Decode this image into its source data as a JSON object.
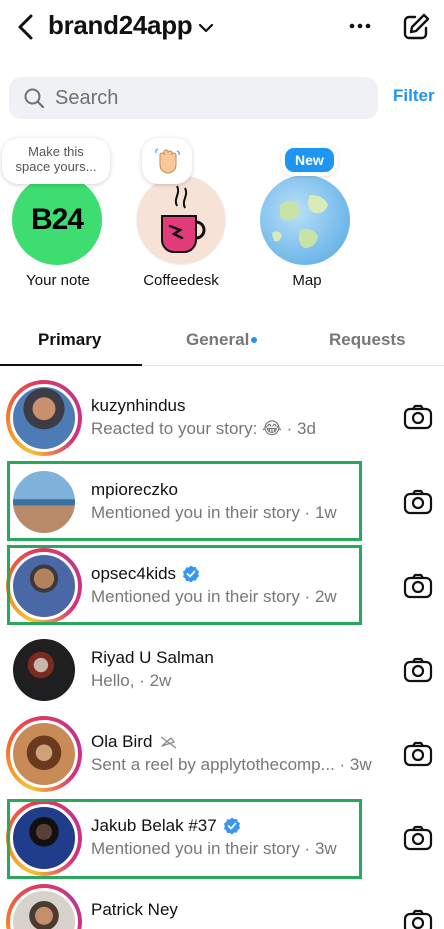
{
  "header": {
    "title": "brand24app",
    "icons": [
      "back-icon",
      "chevron-down-icon",
      "more-icon",
      "compose-icon"
    ]
  },
  "search": {
    "placeholder": "Search",
    "filter_label": "Filter"
  },
  "notes": [
    {
      "label": "Your note",
      "bubble": "Make this space yours...",
      "avatar_text": "B24",
      "avatar_color": "#3ddd72"
    },
    {
      "label": "Coffeedesk",
      "bubble_icon": "waving-hand-icon"
    },
    {
      "label": "Map",
      "badge": "New"
    }
  ],
  "tabs": [
    {
      "label": "Primary",
      "active": true
    },
    {
      "label": "General",
      "unread_dot": true
    },
    {
      "label": "Requests"
    }
  ],
  "threads": [
    {
      "name": "kuzynhindus",
      "message": "Reacted to your story: 😂 · 3d",
      "story": true,
      "highlighted": false
    },
    {
      "name": "mpioreczko",
      "message": "Mentioned you in their story · 1w",
      "story": false,
      "highlighted": true
    },
    {
      "name": "opsec4kids",
      "message": "Mentioned you in their story · 2w",
      "verified": true,
      "story": true,
      "highlighted": true
    },
    {
      "name": "Riyad U Salman",
      "message": "Hello, · 2w",
      "story": false,
      "highlighted": false
    },
    {
      "name": "Ola Bird",
      "message": "Sent a reel by applytothecomp... · 3w",
      "muted": true,
      "story": true,
      "highlighted": false
    },
    {
      "name": "Jakub Belak #37",
      "message": "Mentioned you in their story · 3w",
      "verified": true,
      "story": true,
      "highlighted": true
    },
    {
      "name": "Patrick Ney",
      "message": "",
      "story": true,
      "highlighted": false
    }
  ],
  "colors": {
    "accent": "#1e95f2",
    "highlight_box": "#27a85b",
    "note_green": "#3ddd72"
  }
}
